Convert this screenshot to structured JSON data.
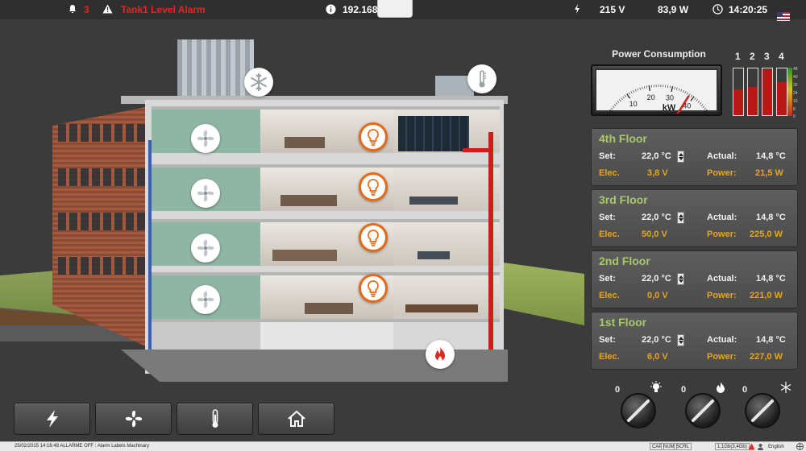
{
  "topbar": {
    "alarm_count": "3",
    "alarm_text": "Tank1 Level Alarm",
    "ip": "192.168.0.55",
    "voltage": "215  V",
    "power": "83,9  W",
    "clock": "14:20:25"
  },
  "power_consumption": {
    "title": "Power Consumption",
    "gauge_unit": "kW",
    "gauge_ticks": [
      "0",
      "10",
      "20",
      "30",
      "40",
      "48"
    ],
    "gauge_value": 38,
    "gauge_max": 48,
    "bar_labels": [
      "1",
      "2",
      "3",
      "4"
    ],
    "bar_levels": [
      0.55,
      0.6,
      0.98,
      0.7
    ],
    "scale_labels": [
      "48",
      "40",
      "32",
      "24",
      "16",
      "8",
      "0"
    ]
  },
  "floors": [
    {
      "title": "4th Floor",
      "set_label": "Set:",
      "set_value": "22,0 °C",
      "actual_label": "Actual:",
      "actual_value": "14,8 °C",
      "elec_label": "Elec.",
      "elec_value": "3,8  V",
      "power_label": "Power:",
      "power_value": "21,5 W"
    },
    {
      "title": "3rd Floor",
      "set_label": "Set:",
      "set_value": "22,0 °C",
      "actual_label": "Actual:",
      "actual_value": "14,8 °C",
      "elec_label": "Elec.",
      "elec_value": "50,0  V",
      "power_label": "Power:",
      "power_value": "225,0 W"
    },
    {
      "title": "2nd Floor",
      "set_label": "Set:",
      "set_value": "22,0 °C",
      "actual_label": "Actual:",
      "actual_value": "14,8 °C",
      "elec_label": "Elec.",
      "elec_value": "0,0  V",
      "power_label": "Power:",
      "power_value": "221,0 W"
    },
    {
      "title": "1st Floor",
      "set_label": "Set:",
      "set_value": "22,0 °C",
      "actual_label": "Actual:",
      "actual_value": "14,8 °C",
      "elec_label": "Elec.",
      "elec_value": "6,0  V",
      "power_label": "Power:",
      "power_value": "227,0 W"
    }
  ],
  "knobs": [
    {
      "value": "0",
      "icon": "lightbulb-icon"
    },
    {
      "value": "0",
      "icon": "flame-icon"
    },
    {
      "value": "0",
      "icon": "snowflake-icon"
    }
  ],
  "nav_buttons": [
    {
      "icon": "lightning-icon"
    },
    {
      "icon": "fan-icon"
    },
    {
      "icon": "thermometer-icon"
    },
    {
      "icon": "home-icon"
    }
  ],
  "statusbar": {
    "message": "25/02/2015 14:16:48 ALLARME OFF : Alarm Labels Machinary",
    "caps": "CAP",
    "num": "NUM",
    "scrl": "SCRL",
    "memory": "1,1Gb(3,4Gb)",
    "language": "English"
  },
  "colors": {
    "accent_green": "#a8c96a",
    "accent_yellow": "#e7a521",
    "alarm_red": "#e3261e",
    "overlay_orange": "#e66a16"
  }
}
